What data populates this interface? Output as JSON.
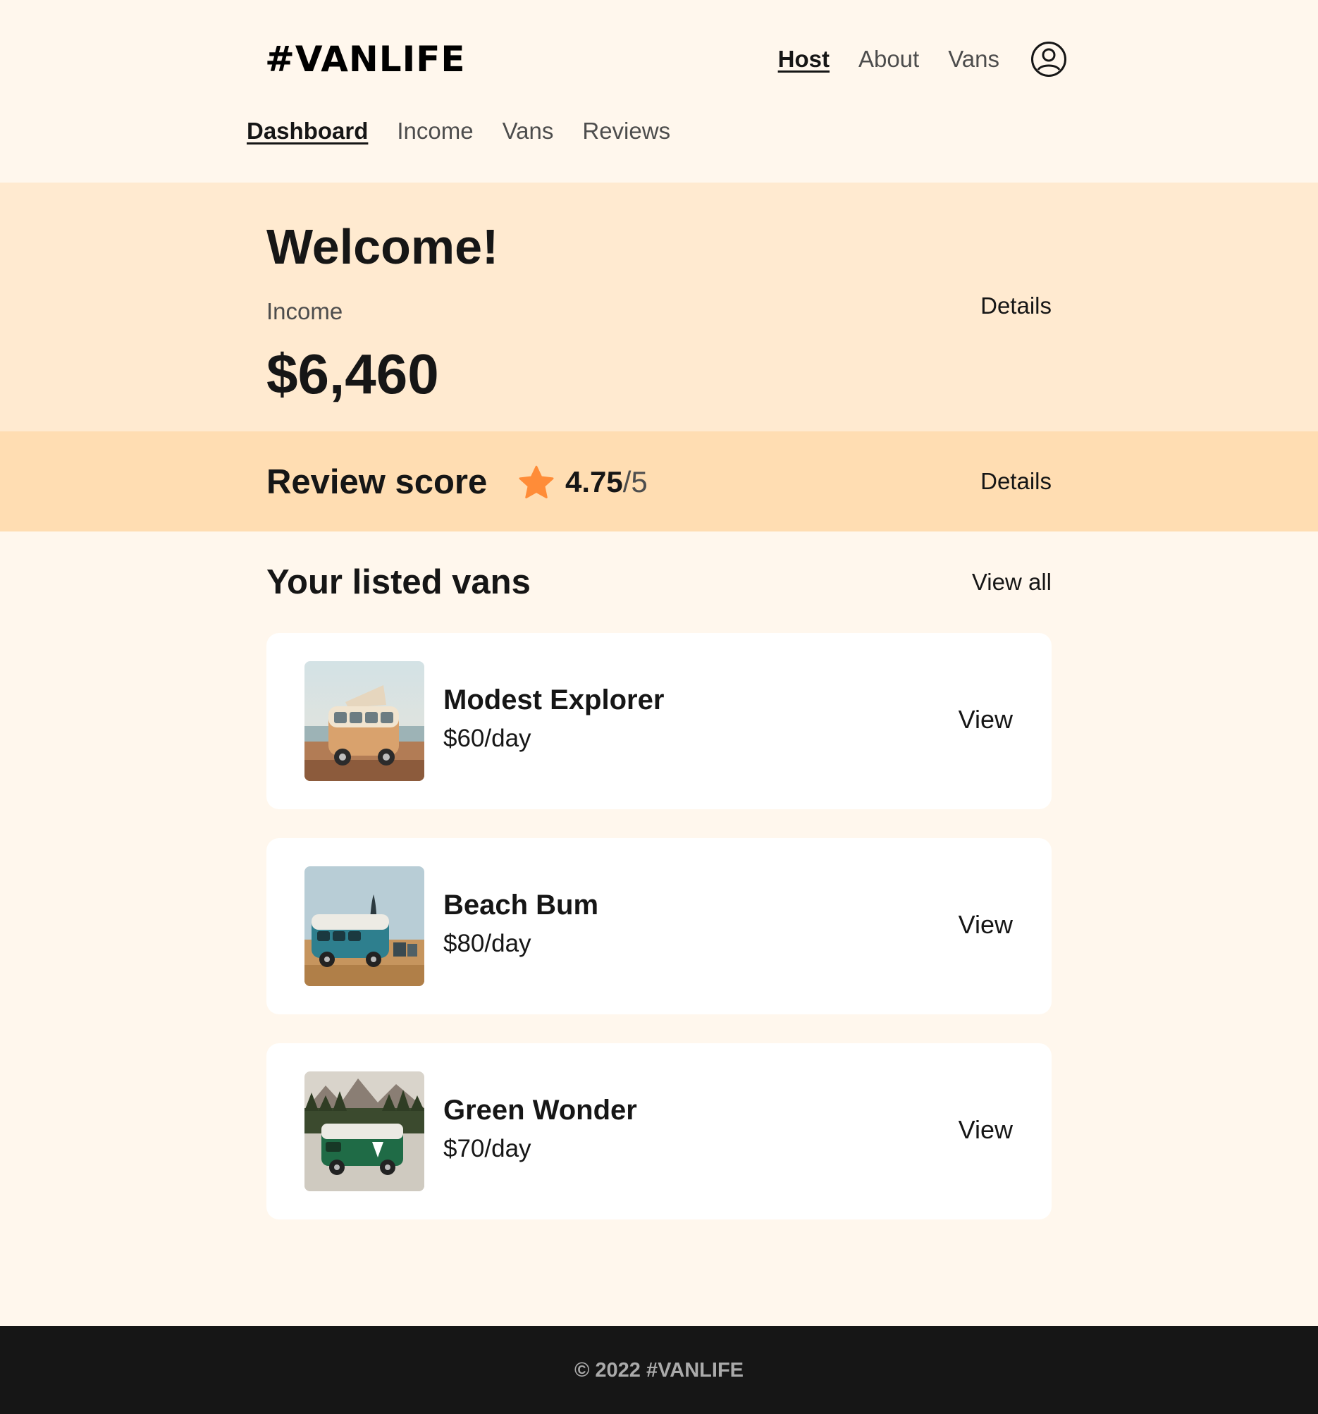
{
  "header": {
    "logo": "#VANLIFE",
    "nav": {
      "host": "Host",
      "about": "About",
      "vans": "Vans"
    },
    "avatar_icon": "user-circle-icon"
  },
  "host_nav": {
    "dashboard": "Dashboard",
    "income": "Income",
    "vans": "Vans",
    "reviews": "Reviews"
  },
  "income_section": {
    "title": "Welcome!",
    "label": "Income",
    "value": "$6,460",
    "details": "Details"
  },
  "review_section": {
    "title": "Review score",
    "star_icon": "star-icon",
    "score": "4.75",
    "max": "/5",
    "details": "Details",
    "star_color": "#FF8C38"
  },
  "vans_section": {
    "title": "Your listed vans",
    "view_all": "View all",
    "vans": [
      {
        "name": "Modest Explorer",
        "price": "$60/day",
        "view": "View"
      },
      {
        "name": "Beach Bum",
        "price": "$80/day",
        "view": "View"
      },
      {
        "name": "Green Wonder",
        "price": "$70/day",
        "view": "View"
      }
    ]
  },
  "footer": {
    "text": "© 2022 #VANLIFE"
  },
  "colors": {
    "page_bg": "#FFF7ED",
    "income_bg": "#FFEAD0",
    "review_bg": "#FFDDB2",
    "footer_bg": "#161616",
    "text": "#161616",
    "muted": "#4D4D4D"
  }
}
